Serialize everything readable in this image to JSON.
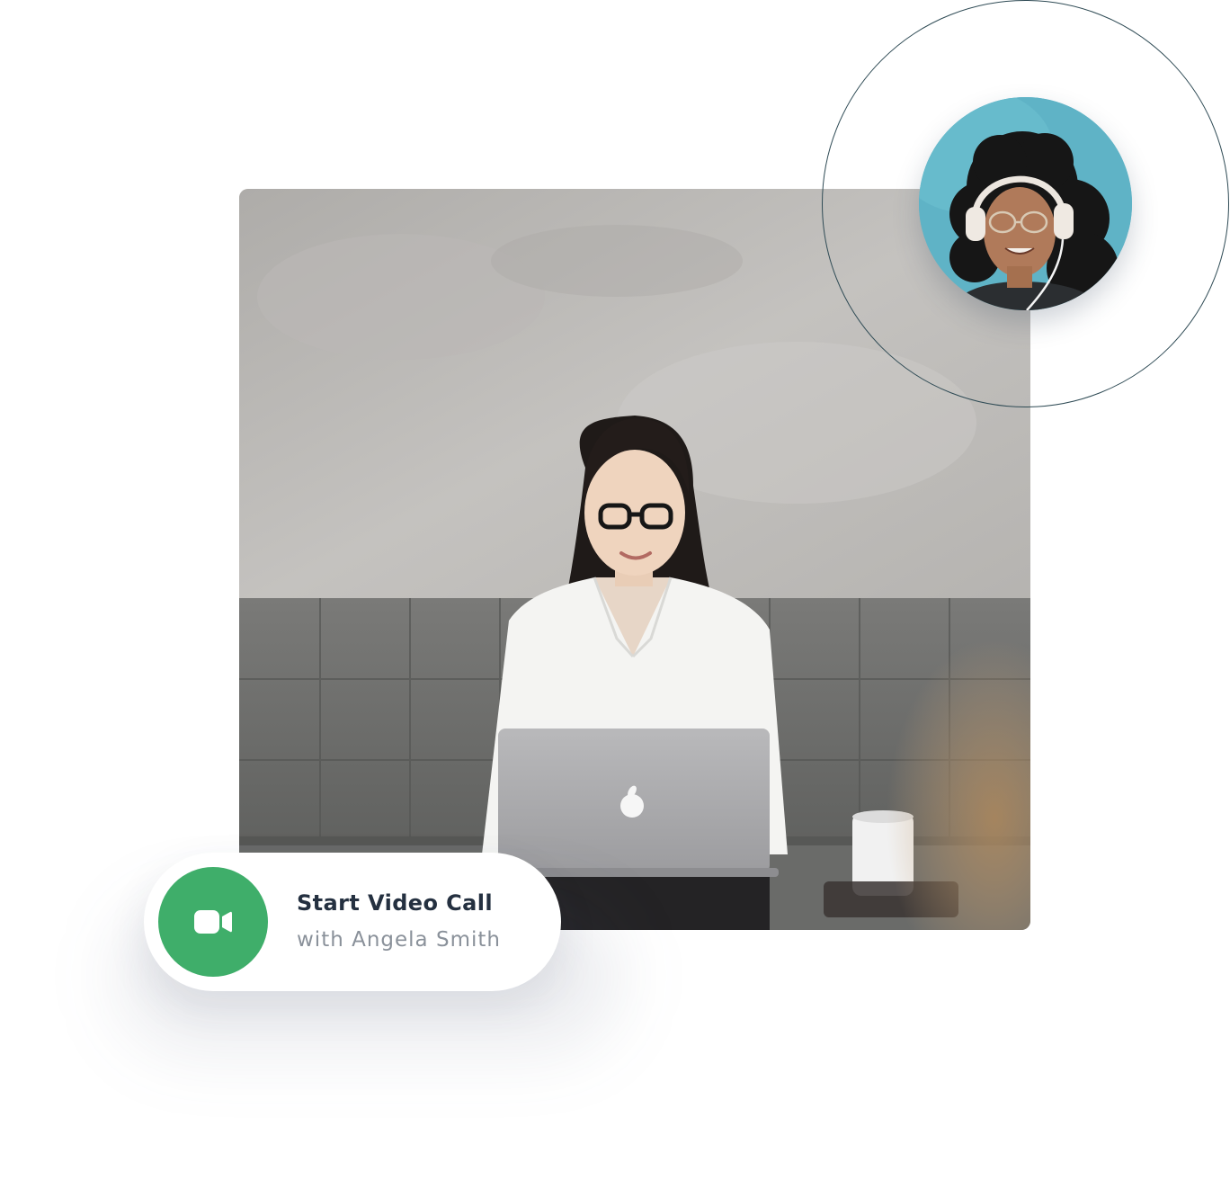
{
  "call_card": {
    "title": "Start Video Call",
    "subtitle": "with Angela Smith",
    "icon": "video-camera-icon",
    "button_color": "#3fae6a"
  },
  "colors": {
    "orbit_ring": "#2f4b55",
    "avatar_background": "#5fb3c6"
  }
}
